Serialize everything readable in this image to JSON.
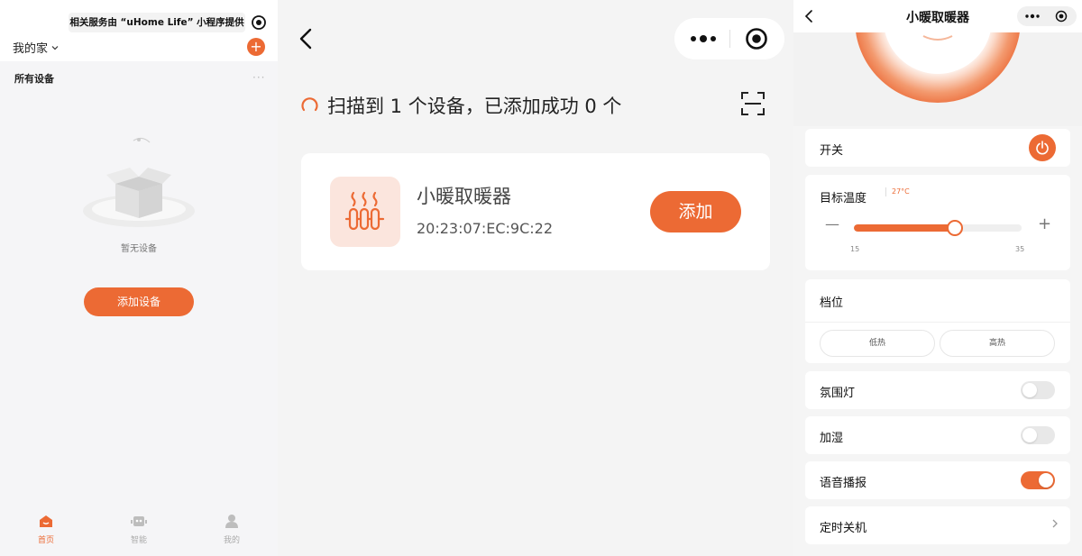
{
  "colors": {
    "accent": "#ec6a34",
    "accent_light": "#fbe5dd"
  },
  "home": {
    "notice": "相关服务由 “uHome Life” 小程序提供",
    "home_name": "我的家",
    "section_title": "所有设备",
    "more": "···",
    "empty_text": "暂无设备",
    "add_button": "添加设备",
    "tabs": [
      {
        "label": "首页",
        "icon": "home-icon",
        "active": true
      },
      {
        "label": "智能",
        "icon": "robot-icon",
        "active": false
      },
      {
        "label": "我的",
        "icon": "user-icon",
        "active": false
      }
    ]
  },
  "scan": {
    "status": "扫描到 1 个设备，已添加成功 0 个",
    "device": {
      "name": "小暖取暖器",
      "mac": "20:23:07:EC:9C:22",
      "icon": "heater-icon",
      "add_label": "添加"
    }
  },
  "device": {
    "title": "小暖取暖器",
    "power": {
      "label": "开关",
      "on": true
    },
    "temperature": {
      "label": "目标温度",
      "value_text": "27°C",
      "value": 27,
      "min": 15,
      "max": 35,
      "min_label": "15",
      "max_label": "35"
    },
    "gear": {
      "label": "档位",
      "options": [
        "低热",
        "高热"
      ]
    },
    "ambient_light": {
      "label": "氛围灯",
      "on": false
    },
    "humidify": {
      "label": "加湿",
      "on": false
    },
    "voice": {
      "label": "语音播报",
      "on": true
    },
    "timer": {
      "label": "定时关机"
    }
  }
}
